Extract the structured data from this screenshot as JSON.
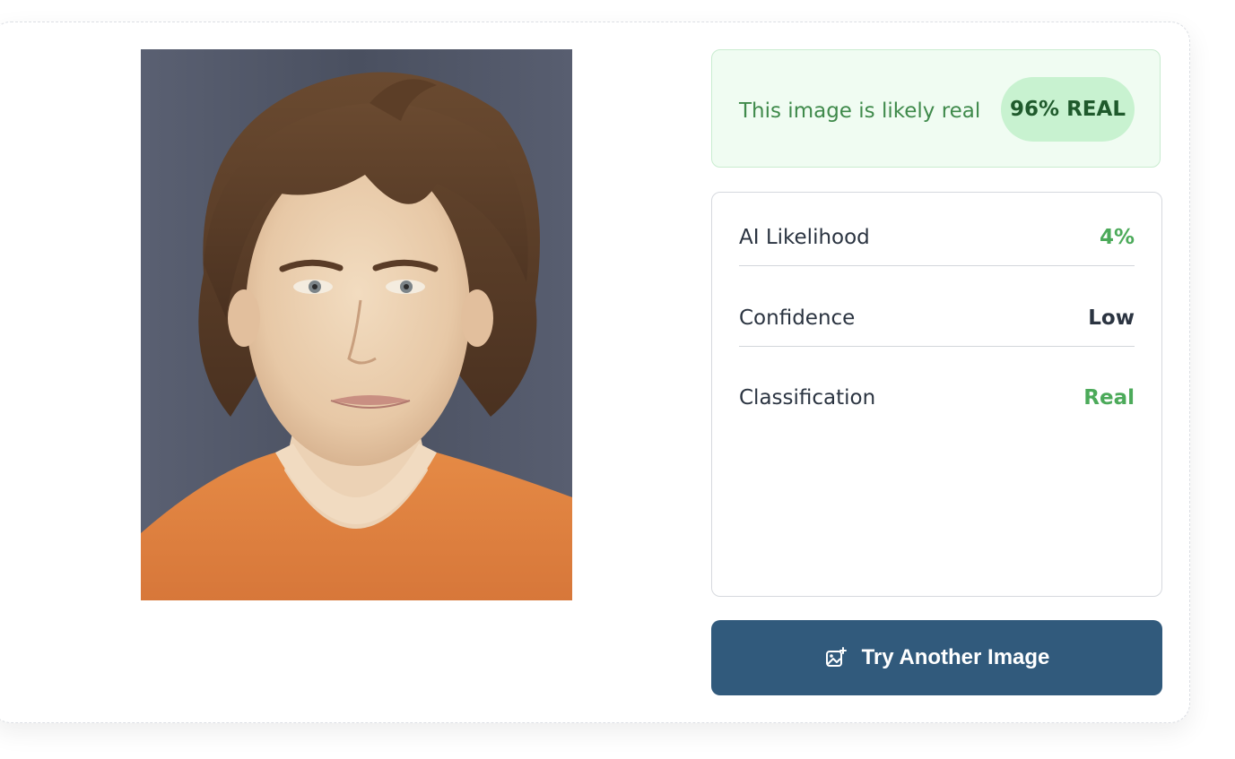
{
  "image": {
    "alt": "Uploaded portrait photo"
  },
  "verdict": {
    "text": "This image is likely real",
    "badge": "96% REAL",
    "score_percent": 96,
    "color": "#3f8a4b",
    "background": "#f0fcf2"
  },
  "stats": [
    {
      "label": "AI Likelihood",
      "value": "4%",
      "color": "#4caa5a"
    },
    {
      "label": "Confidence",
      "value": "Low",
      "color": "#2b3441"
    },
    {
      "label": "Classification",
      "value": "Real",
      "color": "#4caa5a"
    }
  ],
  "actions": {
    "try_another_label": "Try Another Image",
    "try_another_icon": "image-add-icon",
    "color": "#315a7c"
  }
}
